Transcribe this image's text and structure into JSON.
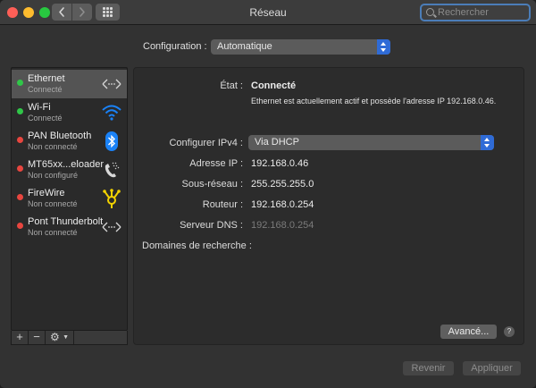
{
  "window": {
    "title": "Réseau"
  },
  "search": {
    "placeholder": "Rechercher"
  },
  "configuration": {
    "label": "Configuration :",
    "value": "Automatique"
  },
  "services": [
    {
      "name": "Ethernet",
      "status": "Connecté",
      "dot_color": "#30c648",
      "icon": "ethernet-arrows-icon"
    },
    {
      "name": "Wi-Fi",
      "status": "Connecté",
      "dot_color": "#30c648",
      "icon": "wifi-icon"
    },
    {
      "name": "PAN Bluetooth",
      "status": "Non connecté",
      "dot_color": "#e8463f",
      "icon": "bluetooth-icon"
    },
    {
      "name": "MT65xx...eloader",
      "status": "Non configuré",
      "dot_color": "#e8463f",
      "icon": "phone-icon"
    },
    {
      "name": "FireWire",
      "status": "Non connecté",
      "dot_color": "#e8463f",
      "icon": "firewire-icon"
    },
    {
      "name": "Pont Thunderbolt",
      "status": "Non connecté",
      "dot_color": "#e8463f",
      "icon": "ethernet-arrows-icon"
    }
  ],
  "sidebar_tools": {
    "add": "+",
    "remove": "−",
    "gear": "⚙"
  },
  "detail": {
    "state_label": "État :",
    "state_value": "Connecté",
    "state_desc": "Ethernet est actuellement actif et possède l'adresse IP 192.168.0.46.",
    "ipv4_label": "Configurer IPv4 :",
    "ipv4_value": "Via DHCP",
    "ip_label": "Adresse IP :",
    "ip_value": "192.168.0.46",
    "subnet_label": "Sous-réseau :",
    "subnet_value": "255.255.255.0",
    "router_label": "Routeur :",
    "router_value": "192.168.0.254",
    "dns_label": "Serveur DNS :",
    "dns_value": "192.168.0.254",
    "domains_label": "Domaines de recherche :",
    "advanced_button": "Avancé...",
    "help": "?"
  },
  "footer": {
    "revert": "Revenir",
    "apply": "Appliquer"
  },
  "colors": {
    "accent": "#2f6bd6",
    "connected": "#30c648",
    "disconnected": "#e8463f",
    "bluetooth": "#1a82f7",
    "firewire": "#f2d200",
    "wifi": "#1a82f7"
  }
}
